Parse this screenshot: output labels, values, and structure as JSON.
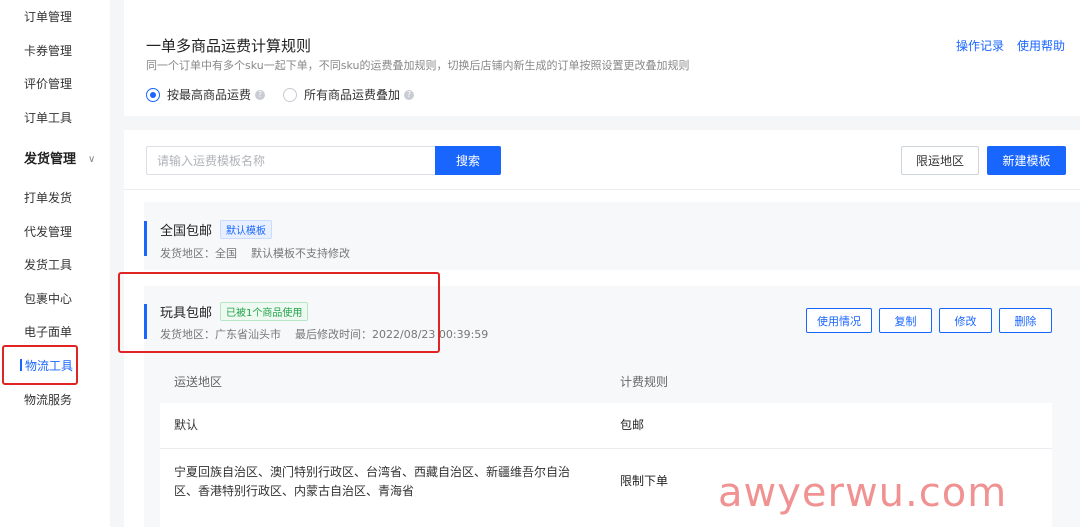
{
  "sidebar": {
    "items_top": [
      "订单管理",
      "卡券管理",
      "评价管理",
      "订单工具"
    ],
    "group_label": "发货管理",
    "group_items": [
      "打单发货",
      "代发管理",
      "发货工具",
      "包裹中心",
      "电子面单",
      "物流工具",
      "物流服务"
    ]
  },
  "rule": {
    "title": "一单多商品运费计算规则",
    "description": "同一个订单中有多个sku一起下单，不同sku的运费叠加规则，切换后店铺内新生成的订单按照设置更改叠加规则",
    "option_max": "按最高商品运费",
    "option_sum": "所有商品运费叠加",
    "help_glyph": "?",
    "link_log": "操作记录",
    "link_help": "使用帮助"
  },
  "toolbar": {
    "search_placeholder": "请输入运费模板名称",
    "search_label": "搜索",
    "limit_region_label": "限运地区",
    "new_template_label": "新建模板"
  },
  "templates": [
    {
      "name": "全国包邮",
      "tag": "默认模板",
      "region": "发货地区：全国",
      "note": "默认模板不支持修改"
    },
    {
      "name": "玩具包邮",
      "tag": "已被1个商品使用",
      "region": "发货地区：广东省汕头市",
      "modified": "最后修改时间：2022/08/23 00:39:59",
      "actions": [
        "使用情况",
        "复制",
        "修改",
        "删除"
      ]
    }
  ],
  "table": {
    "headers": [
      "运送地区",
      "计费规则"
    ],
    "rows": [
      {
        "region_line1": "默认",
        "region_line2": "",
        "rule": "包邮"
      },
      {
        "region_line1": "宁夏回族自治区、澳门特别行政区、台湾省、西藏自治区、新疆维吾尔自治",
        "region_line2": "区、香港特别行政区、内蒙古自治区、青海省",
        "rule": "限制下单"
      }
    ]
  },
  "watermark": "awyerwu.com",
  "colors": {
    "primary": "#1966ff",
    "highlight_box": "#e02424",
    "tag_green": "#22a34a"
  }
}
